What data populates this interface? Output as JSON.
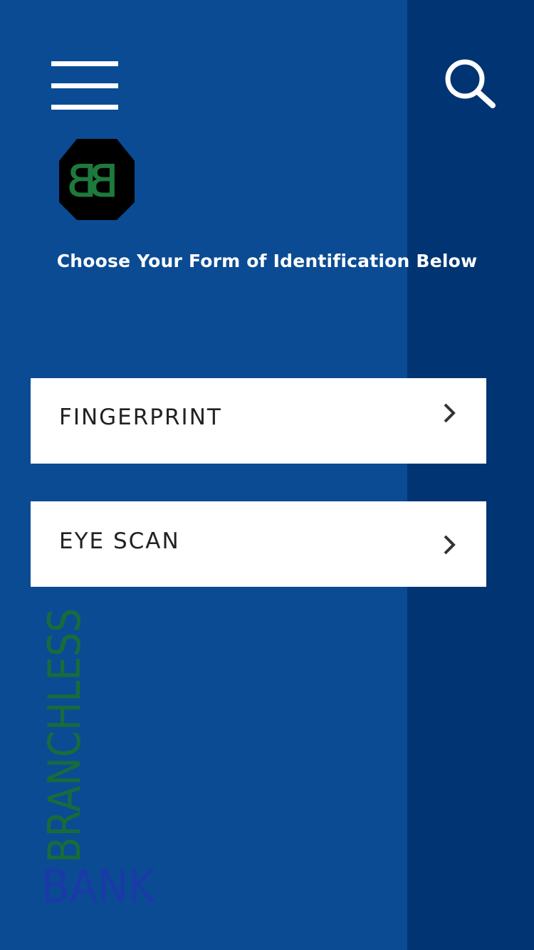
{
  "header": {
    "menu_icon": "hamburger-menu-icon",
    "search_icon": "search-icon"
  },
  "brand": {
    "logo_icon": "bb-hexagon-logo",
    "logo_letters": "BB",
    "wordmark_top": "BRANCHLESS",
    "wordmark_bottom": "BANK",
    "logo_color": "#1e7a3c",
    "wordmark_top_color": "#1a6b3c",
    "wordmark_bottom_color": "#1a3aa8"
  },
  "main": {
    "heading": "Choose Your Form of Identification Below",
    "options": [
      {
        "label": "FINGERPRINT",
        "icon": "chevron-right-icon"
      },
      {
        "label": "EYE SCAN",
        "icon": "chevron-right-icon"
      }
    ]
  },
  "colors": {
    "background": "#0b4b93",
    "band": "#003473",
    "button_bg": "#ffffff",
    "button_text": "#222222",
    "heading_text": "#ffffff"
  }
}
